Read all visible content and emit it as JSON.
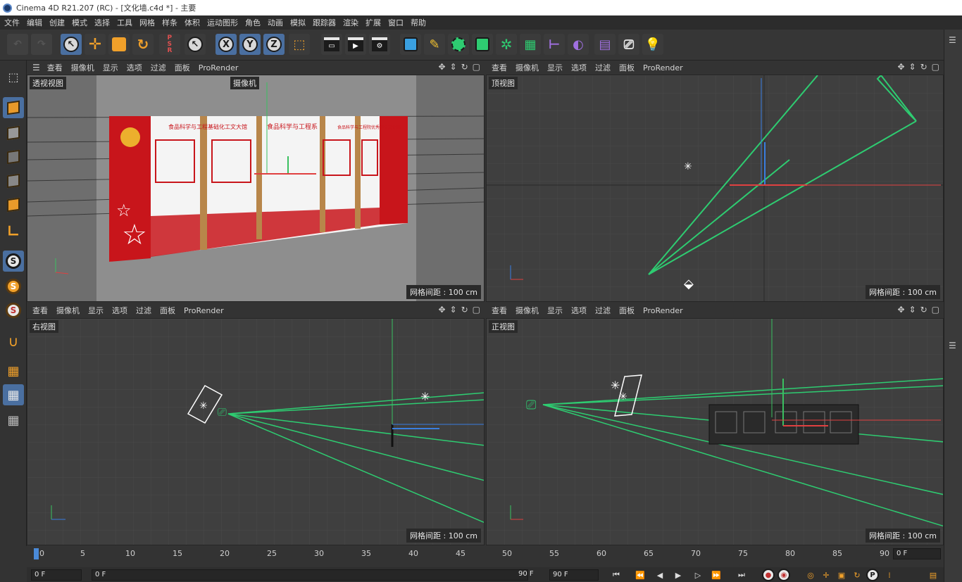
{
  "window": {
    "title": "Cinema 4D R21.207 (RC) - [文化墙.c4d *] - 主要"
  },
  "menubar": {
    "items": [
      "文件",
      "编辑",
      "创建",
      "模式",
      "选择",
      "工具",
      "网格",
      "样条",
      "体积",
      "运动图形",
      "角色",
      "动画",
      "模拟",
      "跟踪器",
      "渲染",
      "扩展",
      "窗口",
      "帮助"
    ]
  },
  "toolbar": {
    "icons": [
      "undo-icon",
      "redo-icon",
      "live-selection-icon",
      "move-icon",
      "scale-icon",
      "rotate-icon",
      "psr-icon",
      "select-icon",
      "x-axis-icon",
      "y-axis-icon",
      "z-axis-icon",
      "coordinate-system-icon",
      "render-region-icon",
      "render-view-icon",
      "render-settings-icon",
      "cube-icon",
      "pen-icon",
      "subdivision-icon",
      "extrude-icon",
      "cloner-icon",
      "array-icon",
      "symmetry-icon",
      "deformer-icon",
      "floor-icon",
      "camera-icon",
      "light-icon"
    ],
    "axis_labels": [
      "X",
      "Y",
      "Z"
    ]
  },
  "viewports": {
    "menu": [
      "查看",
      "摄像机",
      "显示",
      "选项",
      "过滤",
      "面板",
      "ProRender"
    ],
    "perspective": {
      "label": "透视视图",
      "camera_label": "摄像机",
      "grid": "网格间距 : 100 cm"
    },
    "top": {
      "label": "顶视图",
      "grid": "网格间距 : 100 cm"
    },
    "right": {
      "label": "右视图",
      "grid": "网格间距 : 100 cm"
    },
    "front": {
      "label": "正视图",
      "grid": "网格间距 : 100 cm"
    },
    "wall_panels": [
      "食品科学与工程基础化工文大馆",
      "食品科学与工程系",
      "食品科学与工程院优秀学生文化展"
    ]
  },
  "colors": {
    "accent": "#4a6fa0",
    "camera_lines": "#2ecc71",
    "x_axis": "#e04040",
    "y_axis": "#3ac060",
    "z_axis": "#3a7ee0",
    "wall_red": "#c8151b"
  },
  "timeline": {
    "ticks": [
      "0",
      "5",
      "10",
      "15",
      "20",
      "25",
      "30",
      "35",
      "40",
      "45",
      "50",
      "55",
      "60",
      "65",
      "70",
      "75",
      "80",
      "85",
      "90"
    ],
    "current_frame": "0 F"
  },
  "playback": {
    "start_frame": "0 F",
    "preview_start": "0 F",
    "preview_end": "90 F",
    "end_frame": "90 F"
  }
}
